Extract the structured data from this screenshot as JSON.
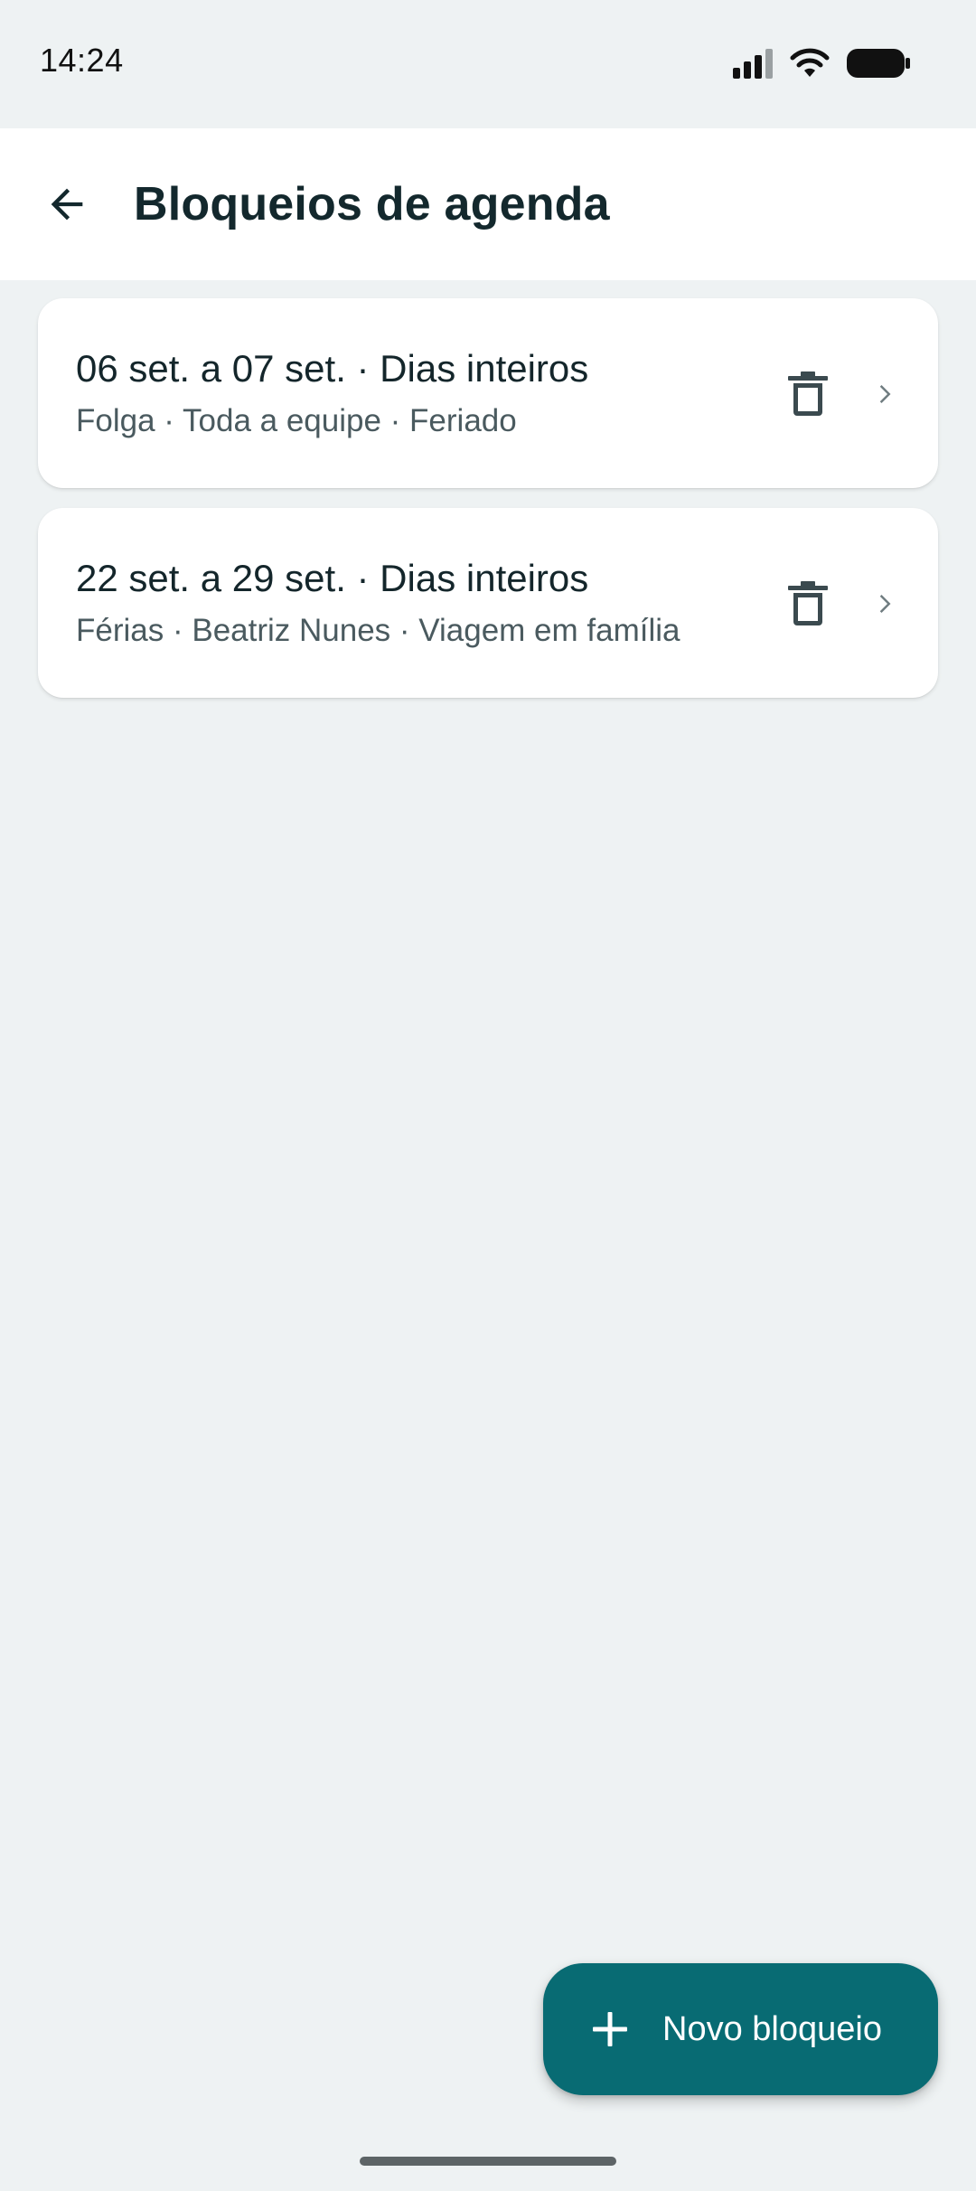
{
  "status_bar": {
    "time": "14:24",
    "icons": [
      "signal-icon",
      "wifi-icon",
      "battery-icon"
    ]
  },
  "app_bar": {
    "back_icon": "arrow-left-icon",
    "title": "Bloqueios de agenda"
  },
  "blocks": [
    {
      "title": "06 set. a 07 set. · Dias inteiros",
      "subtitle": "Folga · Toda a equipe · Feriado",
      "delete_icon": "trash-icon",
      "chevron_icon": "chevron-right-icon"
    },
    {
      "title": "22 set. a 29 set. · Dias inteiros",
      "subtitle": "Férias · Beatriz Nunes · Viagem em família",
      "delete_icon": "trash-icon",
      "chevron_icon": "chevron-right-icon"
    }
  ],
  "fab": {
    "icon": "plus-icon",
    "label": "Novo bloqueio"
  },
  "colors": {
    "background": "#eef2f3",
    "surface": "#ffffff",
    "primary": "#086b73",
    "text_primary": "#14262b",
    "text_secondary": "#4a5a5f",
    "icon": "#3b4a4f"
  }
}
